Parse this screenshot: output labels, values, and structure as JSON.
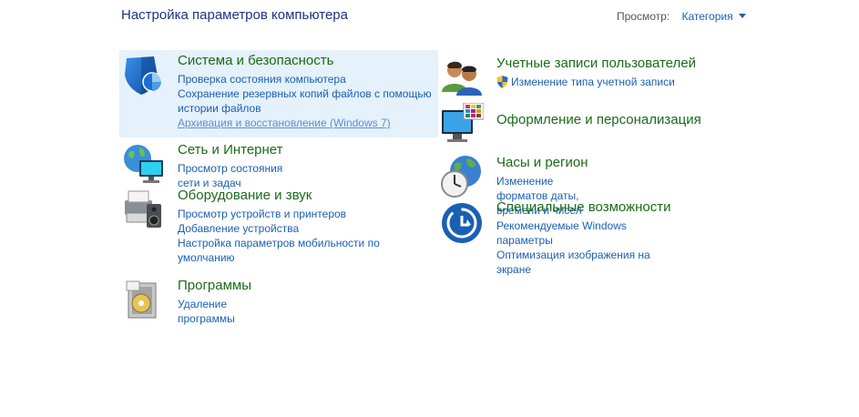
{
  "header": {
    "title": "Настройка параметров компьютера",
    "view_label": "Просмотр:",
    "view_value": "Категория"
  },
  "categories": {
    "system": {
      "title": "Система и безопасность",
      "links": [
        "Проверка состояния компьютера",
        "Сохранение резервных копий файлов с помощью истории файлов",
        "Архивация и восстановление (Windows 7)"
      ],
      "icon": "shield-icon"
    },
    "network": {
      "title": "Сеть и Интернет",
      "links": [
        "Просмотр состояния сети и задач"
      ],
      "icon": "network-globe-icon"
    },
    "hardware": {
      "title": "Оборудование и звук",
      "links": [
        "Просмотр устройств и принтеров",
        "Добавление устройства",
        "Настройка параметров мобильности по умолчанию"
      ],
      "icon": "printer-speaker-icon"
    },
    "programs": {
      "title": "Программы",
      "links": [
        "Удаление программы"
      ],
      "icon": "programs-disc-icon"
    },
    "accounts": {
      "title": "Учетные записи пользователей",
      "links": [
        "Изменение типа учетной записи"
      ],
      "icon": "users-icon"
    },
    "appearance": {
      "title": "Оформление и персонализация",
      "links": [],
      "icon": "monitor-palette-icon"
    },
    "clock": {
      "title": "Часы и регион",
      "links": [
        "Изменение форматов даты, времени и чисел"
      ],
      "icon": "clock-globe-icon"
    },
    "ease": {
      "title": "Специальные возможности",
      "links": [
        "Рекомендуемые Windows параметры",
        "Оптимизация изображения на экране"
      ],
      "icon": "ease-of-access-icon"
    }
  }
}
